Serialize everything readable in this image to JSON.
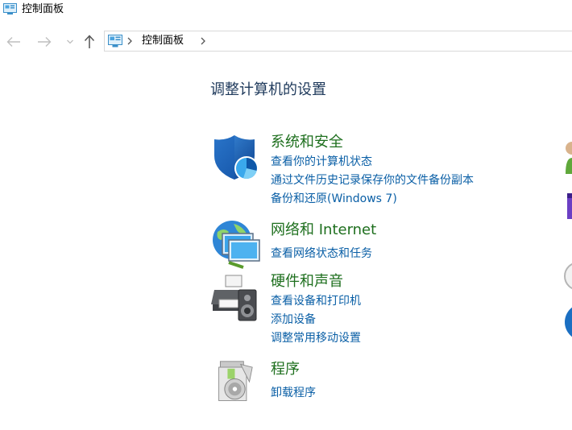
{
  "window": {
    "title": "控制面板"
  },
  "address": {
    "crumb": "控制面板"
  },
  "page": {
    "heading": "调整计算机的设置"
  },
  "categories": [
    {
      "title": "系统和安全",
      "icon": "shield-icon",
      "links": [
        "查看你的计算机状态",
        "通过文件历史记录保存你的文件备份副本",
        "备份和还原(Windows 7)"
      ]
    },
    {
      "title": "网络和 Internet",
      "icon": "network-globe-icon",
      "links": [
        "查看网络状态和任务"
      ]
    },
    {
      "title": "硬件和声音",
      "icon": "printer-speaker-icon",
      "links": [
        "查看设备和打印机",
        "添加设备",
        "调整常用移动设置"
      ]
    },
    {
      "title": "程序",
      "icon": "programs-disc-icon",
      "links": [
        "卸载程序"
      ]
    }
  ],
  "colors": {
    "heading": "#1e395b",
    "category_title": "#1e6f1e",
    "link": "#0a5fa6"
  }
}
